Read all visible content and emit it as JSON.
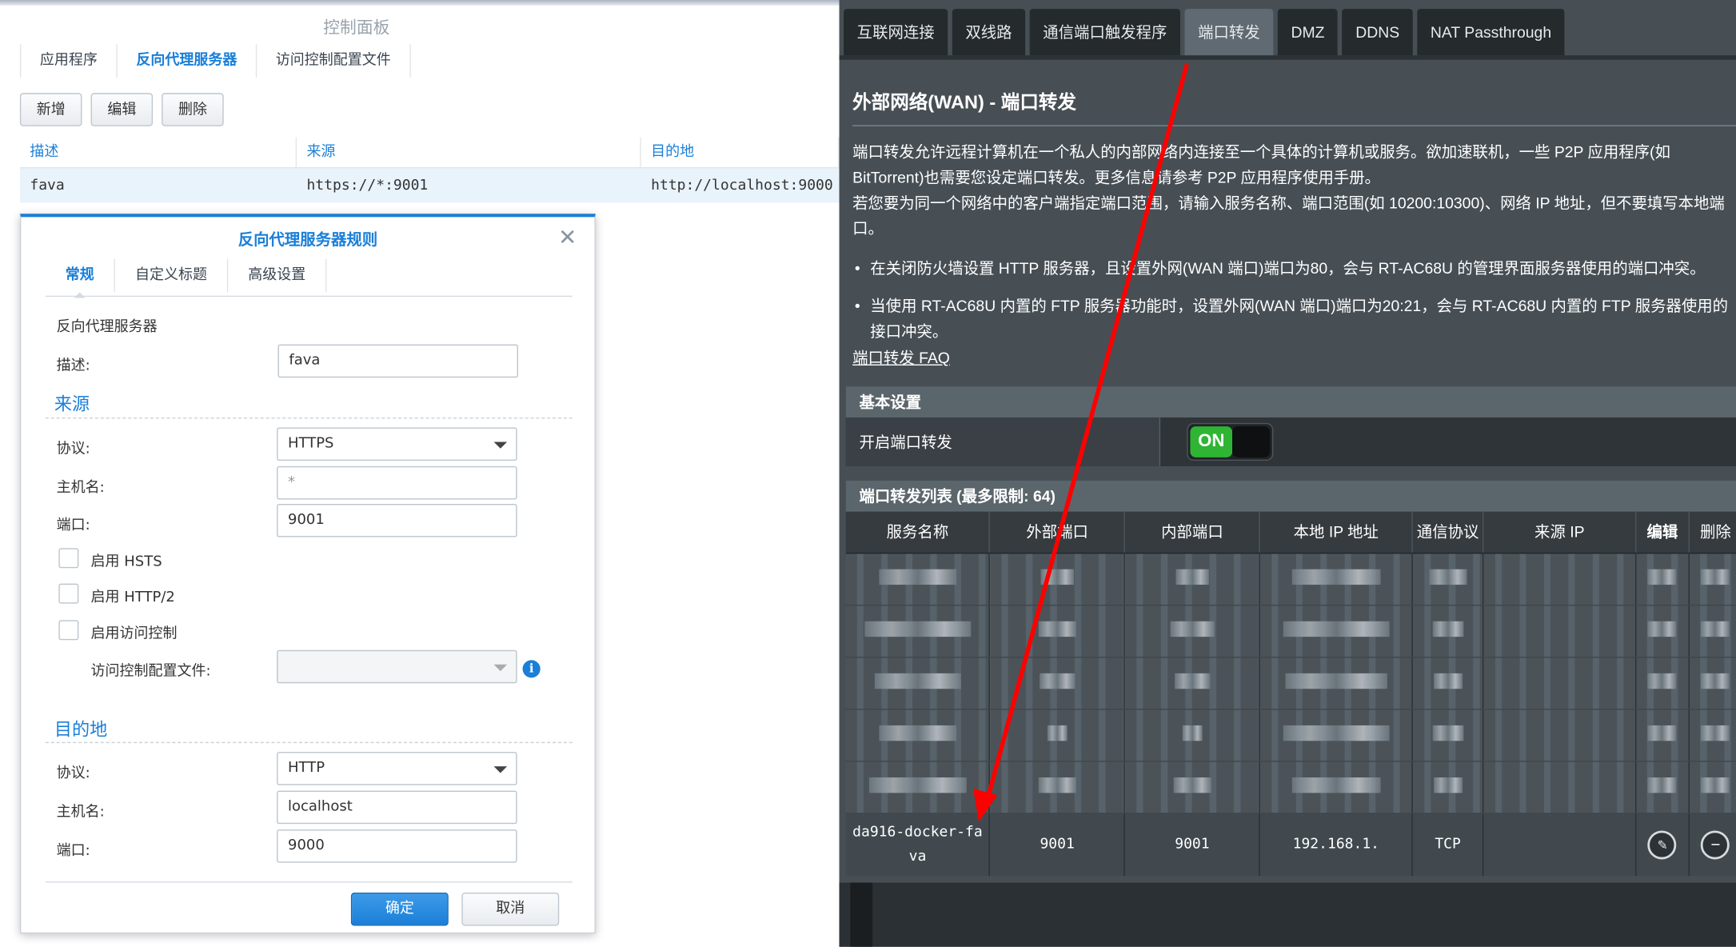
{
  "left": {
    "window_title": "控制面板",
    "tabs": [
      "应用程序",
      "反向代理服务器",
      "访问控制配置文件"
    ],
    "buttons": [
      "新增",
      "编辑",
      "删除"
    ],
    "grid": {
      "headers": [
        "描述",
        "来源",
        "目的地"
      ],
      "rows": [
        [
          "fava",
          "https://*:9001",
          "http://localhost:9000"
        ]
      ]
    },
    "dialog": {
      "title": "反向代理服务器规则",
      "tabs": [
        "常规",
        "自定义标题",
        "高级设置"
      ],
      "section_label": "反向代理服务器",
      "desc_label": "描述:",
      "desc_value": "fava",
      "source": {
        "title": "来源",
        "protocol_label": "协议:",
        "protocol_value": "HTTPS",
        "host_label": "主机名:",
        "host_placeholder": "*",
        "port_label": "端口:",
        "port_value": "9001",
        "hsts_label": "启用 HSTS",
        "http2_label": "启用 HTTP/2",
        "access_control_label": "启用访问控制",
        "acl_profile_label": "访问控制配置文件:"
      },
      "destination": {
        "title": "目的地",
        "protocol_label": "协议:",
        "protocol_value": "HTTP",
        "host_label": "主机名:",
        "host_value": "localhost",
        "port_label": "端口:",
        "port_value": "9000"
      },
      "ok_label": "确定",
      "cancel_label": "取消"
    }
  },
  "right": {
    "tabs": [
      "互联网连接",
      "双线路",
      "通信端口触发程序",
      "端口转发",
      "DMZ",
      "DDNS",
      "NAT Passthrough"
    ],
    "active_tab": "端口转发",
    "heading": "外部网络(WAN) - 端口转发",
    "intro_1": "端口转发允许远程计算机在一个私人的内部网络内连接至一个具体的计算机或服务。欲加速联机，一些 P2P 应用程序(如 BitTorrent)也需要您设定端口转发。更多信息请参考 P2P 应用程序使用手册。",
    "intro_2": "若您要为同一个网络中的客户端指定端口范围，请输入服务名称、端口范围(如 10200:10300)、网络 IP 地址，但不要填写本地端口。",
    "bullet_1": "在关闭防火墙设置 HTTP 服务器，且设置外网(WAN 端口)端口为80，会与 RT-AC68U 的管理界面服务器使用的端口冲突。",
    "bullet_2": "当使用 RT-AC68U 内置的 FTP 服务器功能时，设置外网(WAN 端口)端口为20:21，会与 RT-AC68U 内置的 FTP 服务器使用的接口冲突。",
    "faq_link": "端口转发  FAQ",
    "basic_section": "基本设置",
    "enable_label": "开启端口转发",
    "toggle_value": "ON",
    "list_section": "端口转发列表 (最多限制: 64)",
    "table_headers": [
      "服务名称",
      "外部端口",
      "内部端口",
      "本地 IP 地址",
      "通信协议",
      "来源 IP",
      "编辑",
      "删除"
    ],
    "entry": {
      "service": "da916-docker-fava",
      "external_port": "9001",
      "internal_port": "9001",
      "local_ip": "192.168.1.",
      "protocol": "TCP",
      "source_ip": ""
    },
    "accent_color": "#ff0000"
  }
}
